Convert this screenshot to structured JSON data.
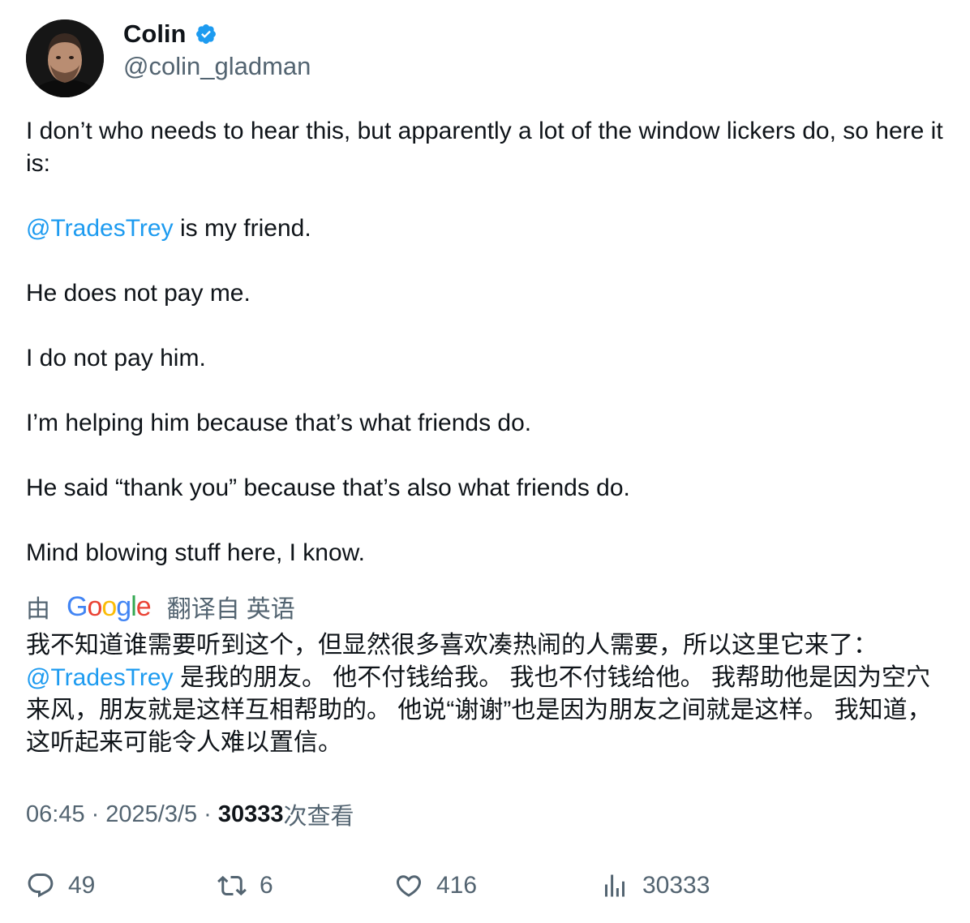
{
  "author": {
    "display_name": "Colin",
    "handle": "@colin_gladman",
    "verified_icon": "verified-badge-icon",
    "badge_color": "#1d9bf0"
  },
  "tweet": {
    "line1": "I don’t who needs to hear this, but apparently a lot of the window lickers do, so here it is:",
    "mention": "@TradesTrey",
    "line2_rest": " is my friend.",
    "line3": "He does not pay me.",
    "line4": "I do not pay him.",
    "line5": "I’m helping him because that’s what friends do.",
    "line6": "He said “thank you” because that’s also what friends do.",
    "line7": "Mind blowing stuff here, I know."
  },
  "translation": {
    "by_prefix": "由",
    "google_g": "G",
    "google_o1": "o",
    "google_o2": "o",
    "google_g2": "g",
    "google_l": "l",
    "google_e": "e",
    "translated_from": "翻译自",
    "language": "英语",
    "text_part1": "我不知道谁需要听到这个，但显然很多喜欢凑热闹的人需要，所以这里它来了：",
    "mention": "@TradesTrey",
    "text_part2": " 是我的朋友。 他不付钱给我。 我也不付钱给他。 我帮助他是因为空穴来风，朋友就是这样互相帮助的。 他说“谢谢”也是因为朋友之间就是这样。 我知道，这听起来可能令人难以置信。"
  },
  "meta": {
    "time": "06:45",
    "separator": "·",
    "date": "2025/3/5",
    "views_count": "30333",
    "views_label": "次查看"
  },
  "actions": {
    "replies": "49",
    "retweets": "6",
    "likes": "416",
    "views": "30333"
  },
  "colors": {
    "link": "#1d9bf0",
    "secondary_text": "#536471",
    "primary_text": "#0f1419"
  }
}
